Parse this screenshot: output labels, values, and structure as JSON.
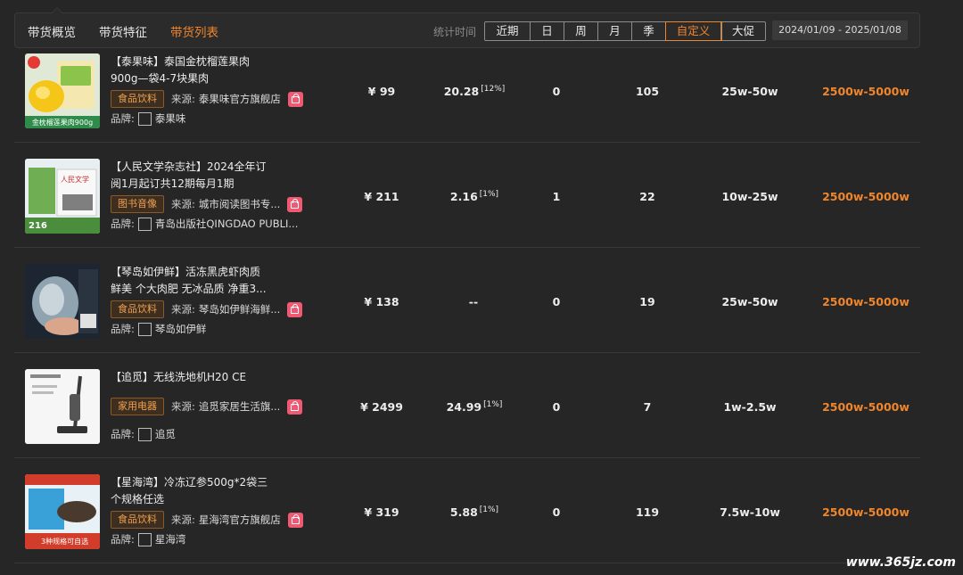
{
  "tabs": [
    {
      "label": "带货概览",
      "active": false
    },
    {
      "label": "带货特征",
      "active": false
    },
    {
      "label": "带货列表",
      "active": true
    }
  ],
  "stat_label": "统计时间",
  "periods": [
    {
      "label": "近期",
      "active": false
    },
    {
      "label": "日",
      "active": false
    },
    {
      "label": "周",
      "active": false
    },
    {
      "label": "月",
      "active": false
    },
    {
      "label": "季",
      "active": false
    },
    {
      "label": "自定义",
      "active": true
    },
    {
      "label": "大促",
      "active": false
    }
  ],
  "date_range": "2024/01/09 - 2025/01/08",
  "source_label": "来源:",
  "brand_label": "品牌:",
  "products": [
    {
      "title_line1": "【泰果味】泰国金枕榴莲果肉",
      "title_line2": "900g—袋4-7块果肉",
      "category": "食品饮料",
      "source": "泰果味官方旗舰店",
      "brand": "泰果味",
      "price": "¥ 99",
      "commission": "20.28",
      "commission_pct": "[12%]",
      "col_a": "0",
      "col_b": "105",
      "col_c": "25w-50w",
      "col_d": "2500w-5000w",
      "thumb_label": "金枕榴莲果肉900g"
    },
    {
      "title_line1": "【人民文学杂志社】2024全年订",
      "title_line2": "阅1月起订共12期每月1期",
      "category": "图书音像",
      "source": "城市阅读图书专...",
      "brand": "青岛出版社QINGDAO PUBLI...",
      "price": "¥ 211",
      "commission": "2.16",
      "commission_pct": "[1%]",
      "col_a": "1",
      "col_b": "22",
      "col_c": "10w-25w",
      "col_d": "2500w-5000w",
      "thumb_label": "216"
    },
    {
      "title_line1": "【琴岛如伊鲜】活冻黑虎虾肉质",
      "title_line2": "鲜美 个大肉肥 无冰品质 净重3...",
      "category": "食品饮料",
      "source": "琴岛如伊鲜海鲜...",
      "brand": "琴岛如伊鲜",
      "price": "¥ 138",
      "commission": "--",
      "commission_pct": "",
      "col_a": "0",
      "col_b": "19",
      "col_c": "25w-50w",
      "col_d": "2500w-5000w",
      "thumb_label": ""
    },
    {
      "title_line1": "【追觅】无线洗地机H20 CE",
      "title_line2": "",
      "category": "家用电器",
      "source": "追觅家居生活旗...",
      "brand": "追觅",
      "price": "¥ 2499",
      "commission": "24.99",
      "commission_pct": "[1%]",
      "col_a": "0",
      "col_b": "7",
      "col_c": "1w-2.5w",
      "col_d": "2500w-5000w",
      "thumb_label": ""
    },
    {
      "title_line1": "【星海湾】冷冻辽参500g*2袋三",
      "title_line2": "个规格任选",
      "category": "食品饮料",
      "source": "星海湾官方旗舰店",
      "brand": "星海湾",
      "price": "¥ 319",
      "commission": "5.88",
      "commission_pct": "[1%]",
      "col_a": "0",
      "col_b": "119",
      "col_c": "7.5w-10w",
      "col_d": "2500w-5000w",
      "thumb_label": "3种规格可自选"
    }
  ],
  "site_mark": "www.365jz.com",
  "colors": {
    "accent": "#f0862c",
    "background": "#262626",
    "tag_border": "#8a5a28",
    "shop_icon": "#ef5a72"
  }
}
